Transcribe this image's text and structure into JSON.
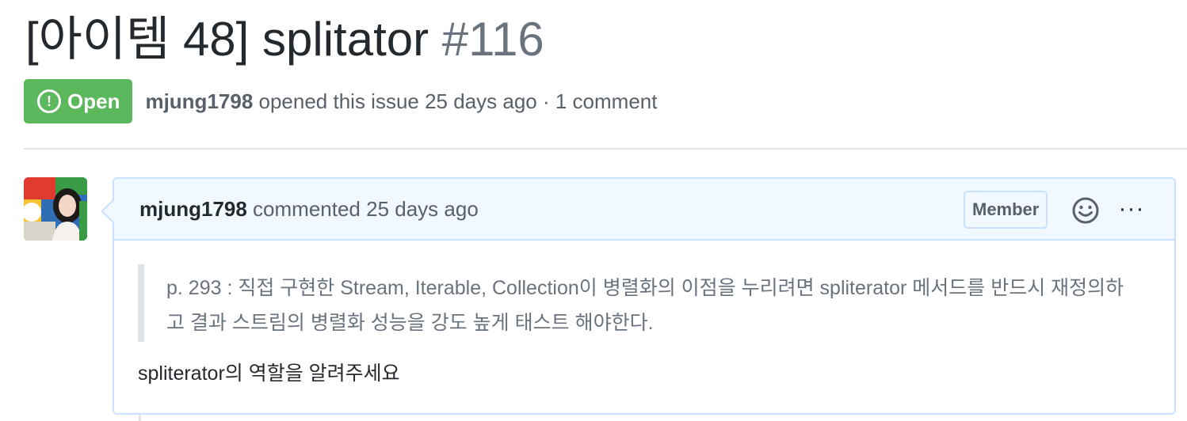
{
  "issue": {
    "title": "[아이템 48] splitator",
    "number": "#116",
    "state": "Open",
    "author": "mjung1798",
    "meta_suffix": " opened this issue 25 days ago · 1 comment"
  },
  "comment": {
    "author": "mjung1798",
    "action_time": " commented 25 days ago",
    "role_badge": "Member",
    "quote": "p. 293 : 직접 구현한 Stream, Iterable, Collection이 병렬화의 이점을 누리려면 spliterator 메서드를 반드시 재정의하고 결과 스트림의 병렬화 성능을 강도 높게 태스트 해야한다.",
    "body": "spliterator의 역할을 알려주세요",
    "more_label": "···"
  },
  "icons": {
    "state": "issue-opened-icon",
    "reaction": "smiley-icon",
    "more": "kebab-horizontal-icon"
  },
  "colors": {
    "open_green": "#5cb85c",
    "header_blue": "#f1f8ff",
    "border_blue": "#c8e1ff",
    "muted": "#586069"
  }
}
